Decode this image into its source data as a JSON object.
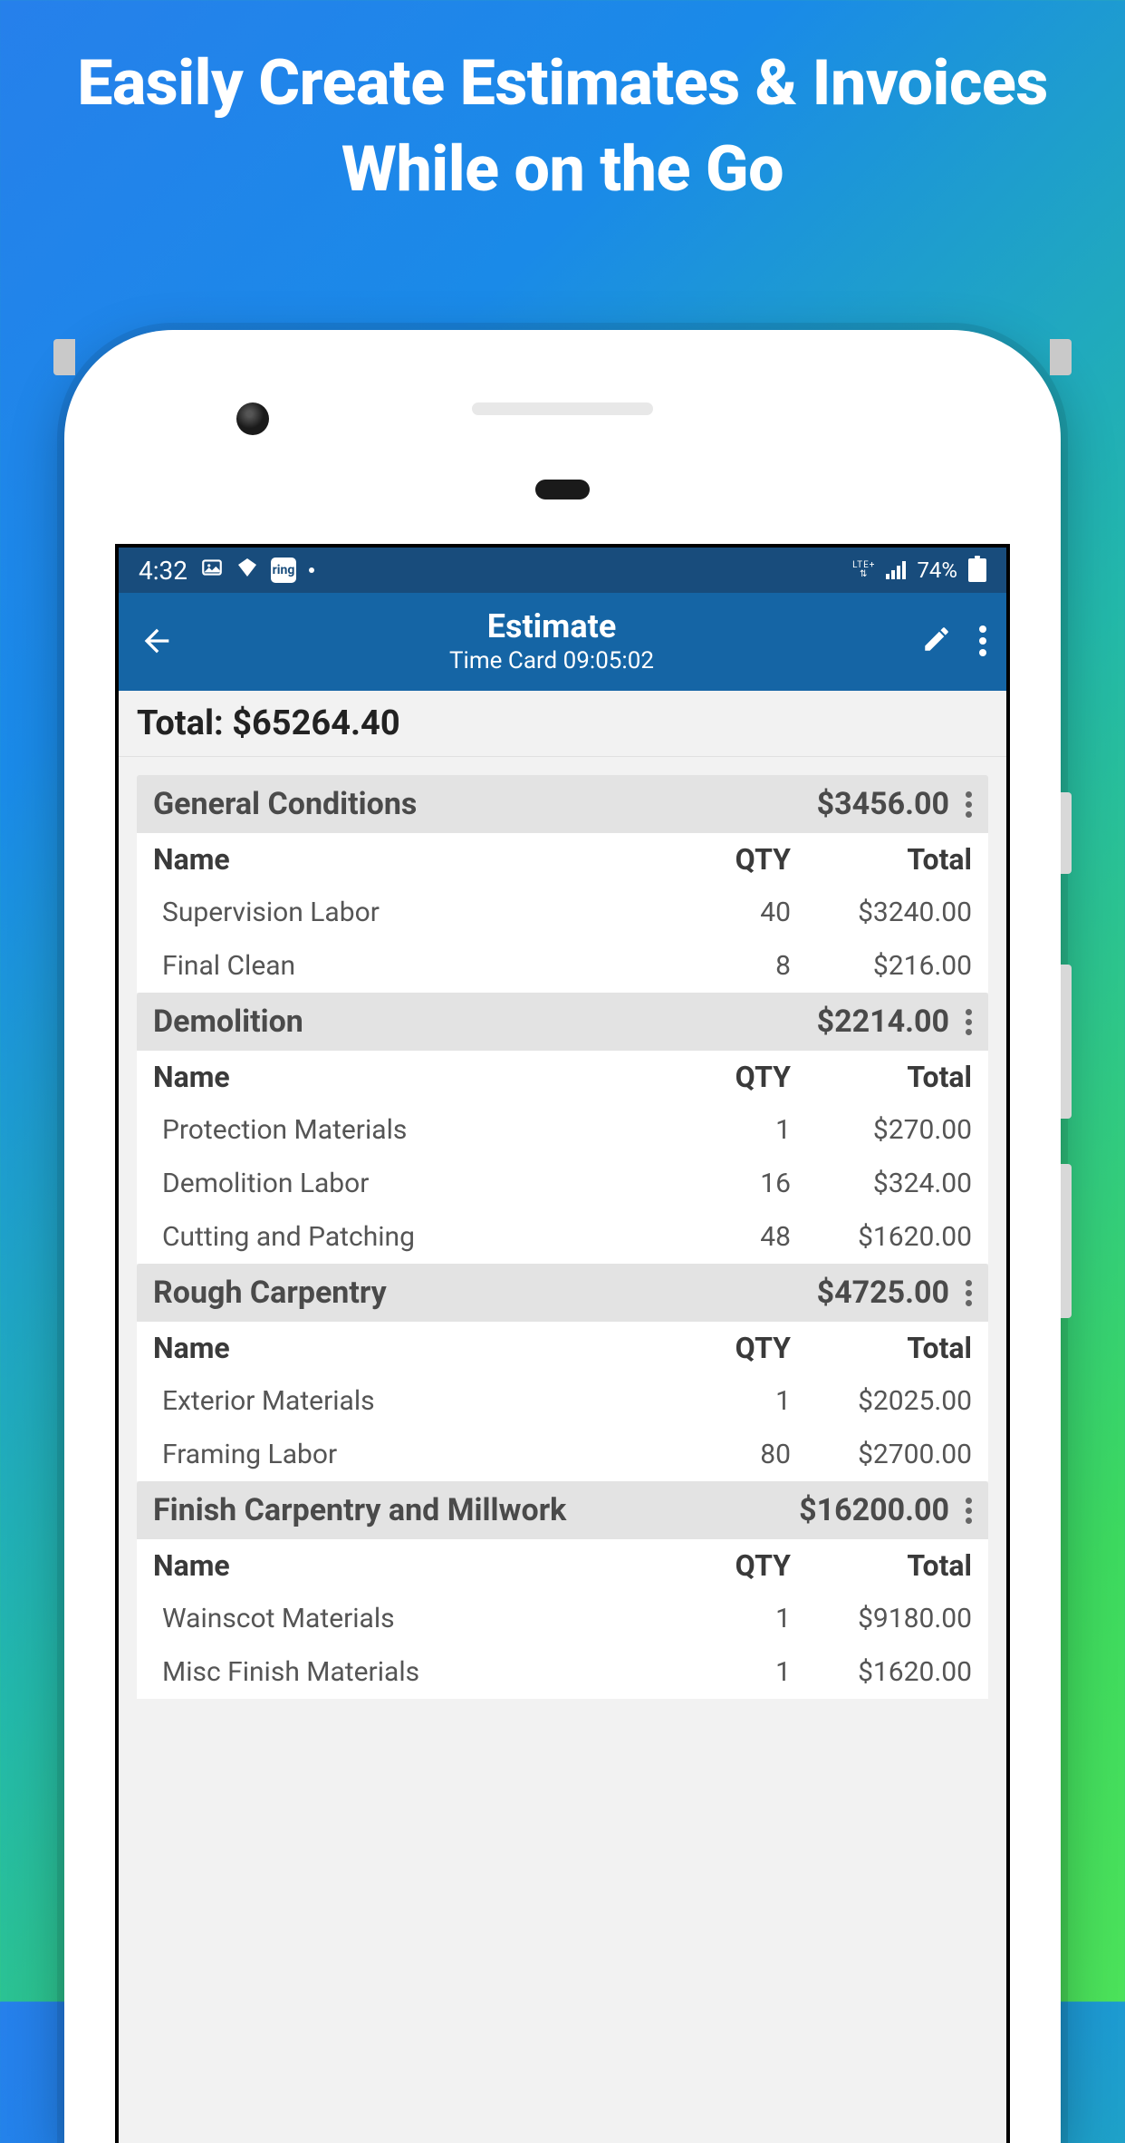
{
  "marketing": {
    "headline": "Easily Create Estimates & Invoices While on the Go"
  },
  "statusBar": {
    "time": "4:32",
    "network": "LTE+",
    "battery": "74%"
  },
  "appBar": {
    "title": "Estimate",
    "subtitle": "Time Card 09:05:02"
  },
  "total": "Total: $65264.40",
  "columns": {
    "name": "Name",
    "qty": "QTY",
    "total": "Total"
  },
  "sections": [
    {
      "title": "General Conditions",
      "total": "$3456.00",
      "items": [
        {
          "name": "Supervision Labor",
          "qty": "40",
          "total": "$3240.00"
        },
        {
          "name": "Final Clean",
          "qty": "8",
          "total": "$216.00"
        }
      ]
    },
    {
      "title": "Demolition",
      "total": "$2214.00",
      "items": [
        {
          "name": "Protection Materials",
          "qty": "1",
          "total": "$270.00"
        },
        {
          "name": "Demolition Labor",
          "qty": "16",
          "total": "$324.00"
        },
        {
          "name": "Cutting and Patching",
          "qty": "48",
          "total": "$1620.00"
        }
      ]
    },
    {
      "title": "Rough Carpentry",
      "total": "$4725.00",
      "items": [
        {
          "name": "Exterior Materials",
          "qty": "1",
          "total": "$2025.00"
        },
        {
          "name": "Framing Labor",
          "qty": "80",
          "total": "$2700.00"
        }
      ]
    },
    {
      "title": "Finish Carpentry and Millwork",
      "total": "$16200.00",
      "items": [
        {
          "name": "Wainscot Materials",
          "qty": "1",
          "total": "$9180.00"
        },
        {
          "name": "Misc Finish Materials",
          "qty": "1",
          "total": "$1620.00"
        }
      ]
    }
  ]
}
